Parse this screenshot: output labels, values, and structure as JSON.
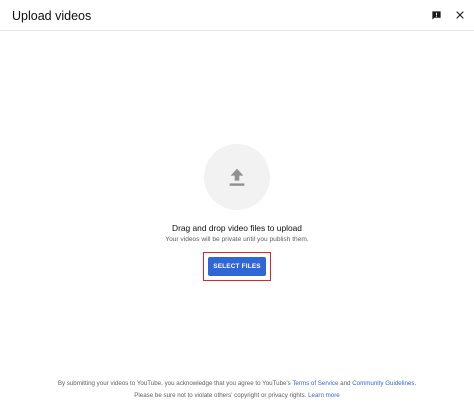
{
  "dialog": {
    "title": "Upload videos"
  },
  "header": {
    "feedback_icon": "feedback-icon",
    "close_icon": "close-icon"
  },
  "main": {
    "upload_icon": "upload-arrow-icon",
    "drag_text": "Drag and drop video files to upload",
    "private_text": "Your videos will be private until you publish them.",
    "select_button_label": "SELECT FILES"
  },
  "footer": {
    "line1_prefix": "By submitting your videos to YouTube, you acknowledge that you agree to YouTube's ",
    "terms_link": "Terms of Service",
    "line1_and": " and ",
    "guidelines_link": "Community Guidelines",
    "line1_suffix": ".",
    "line2_prefix": "Please be sure not to violate others' copyright or privacy rights. ",
    "learn_more_link": "Learn more"
  },
  "colors": {
    "accent": "#3166d6",
    "highlight": "#e0232b",
    "circle_bg": "#f2f2f2",
    "secondary_text": "#606060"
  }
}
